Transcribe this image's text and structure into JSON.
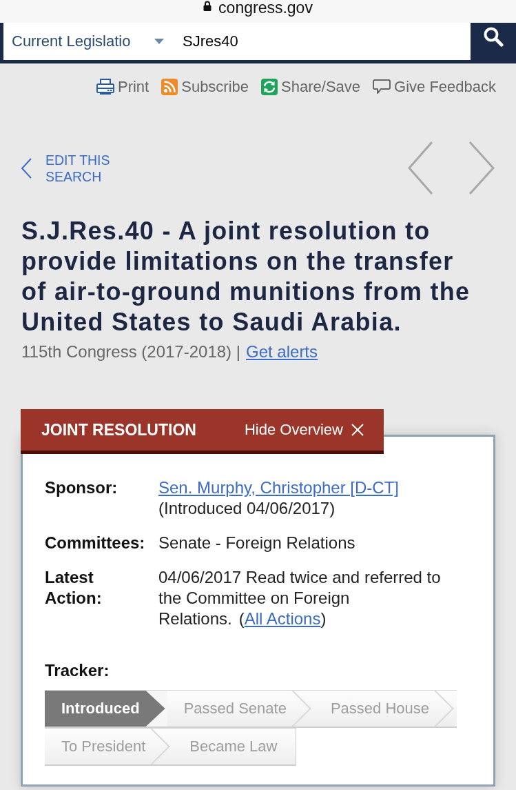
{
  "browser": {
    "address": "congress.gov"
  },
  "search": {
    "scope": "Current Legislatio",
    "query": "SJres40"
  },
  "toolbar": [
    {
      "kind": "print",
      "label": "Print"
    },
    {
      "kind": "subscribe",
      "label": "Subscribe"
    },
    {
      "kind": "share",
      "label": "Share/Save"
    },
    {
      "kind": "feedback",
      "label": "Give Feedback"
    }
  ],
  "edit_search": "EDIT THIS SEARCH",
  "bill": {
    "title": "S.J.Res.40 - A joint resolution to provide limitations on the transfer of air-to-ground munitions from the United States to Saudi Arabia.",
    "congress": "115th Congress (2017-2018) |",
    "alerts_link": "Get alerts"
  },
  "overview": {
    "type": "JOINT RESOLUTION",
    "hide_label": "Hide Overview",
    "sponsor": {
      "label": "Sponsor:",
      "name": "Sen. Murphy, Christopher [D-CT]",
      "introduced": "(Introduced 04/06/2017)"
    },
    "committees": {
      "label": "Committees:",
      "value": "Senate - Foreign Relations"
    },
    "latest_action": {
      "label": "Latest Action:",
      "text": "04/06/2017 Read twice and referred to the Committee on Foreign Relations.",
      "link_open": "(",
      "link": "All Actions",
      "link_close": ")"
    },
    "tracker": {
      "label": "Tracker:",
      "steps": [
        {
          "label": "Introduced",
          "selected": true
        },
        {
          "label": "Passed Senate",
          "selected": false
        },
        {
          "label": "Passed House",
          "selected": false
        },
        {
          "label": "To President",
          "selected": false
        },
        {
          "label": "Became Law",
          "selected": false
        }
      ]
    }
  }
}
